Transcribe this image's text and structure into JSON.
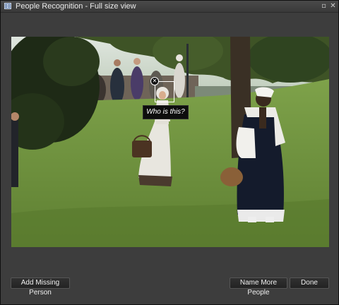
{
  "window": {
    "title": "People Recognition - Full size view",
    "restore_glyph": "▫",
    "close_glyph": "✕"
  },
  "photo": {
    "face_tag": {
      "prompt": "Who is this?",
      "remove_glyph": "✕"
    }
  },
  "buttons": {
    "add_missing": "Add Missing Person",
    "name_more": "Name More People",
    "done": "Done"
  }
}
